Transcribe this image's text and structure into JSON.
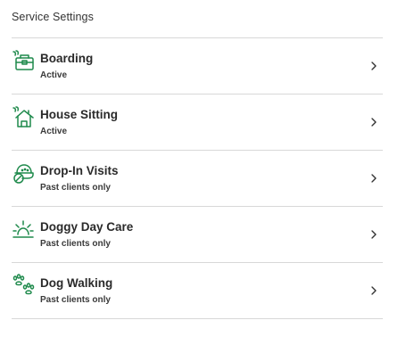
{
  "section": {
    "title": "Service Settings"
  },
  "accent_color": "#1f8a4c",
  "services": [
    {
      "name": "Boarding",
      "status": "Active",
      "icon": "boarding-icon"
    },
    {
      "name": "House Sitting",
      "status": "Active",
      "icon": "house-sitting-icon"
    },
    {
      "name": "Drop-In Visits",
      "status": "Past clients only",
      "icon": "drop-in-visits-icon"
    },
    {
      "name": "Doggy Day Care",
      "status": "Past clients only",
      "icon": "doggy-day-care-icon"
    },
    {
      "name": "Dog Walking",
      "status": "Past clients only",
      "icon": "dog-walking-icon"
    }
  ]
}
